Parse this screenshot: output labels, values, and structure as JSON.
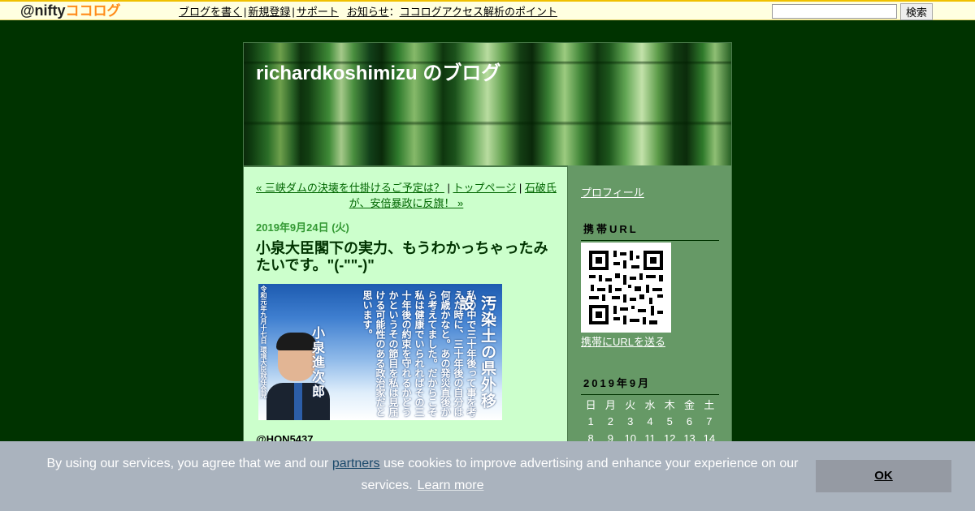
{
  "topbar": {
    "logo_at": "@nifty",
    "logo_kokolog": "ココログ",
    "links": [
      "ブログを書く",
      "新規登録",
      "サポート"
    ],
    "news_label": "お知らせ",
    "news_link": "ココログアクセス解析のポイント",
    "search_button": "検索"
  },
  "blog": {
    "title": "richardkoshimizu のブログ"
  },
  "entry": {
    "prev_link": "« 三峡ダムの決壊を仕掛けるご予定は？",
    "top_link": "トップページ",
    "next_link": "石破氏が、安倍暴政に反旗！ »",
    "date": "2019年9月24日 (火)",
    "title": "小泉大臣閣下の実力、もうわかっちゃったみたいです。\"(-\"\"-)\"",
    "image": {
      "title": "汚染土の県外移設",
      "body": "私の中で三十年後って事を考えた時に、三十年後の自分は何歳かなと。あの発災直後から考えてました。だからこそ私は健康でいられればその三十年後の約束を守れるかどうかというその節目を私は見届ける可能性のある政治家だと思います。",
      "signature": "小泉進次郎",
      "date_text": "令和元年九月十七日 環境大臣就任会見"
    },
    "author": "@HON5437"
  },
  "sidebar": {
    "profile": "プロフィール",
    "mobile_heading": "携帯URL",
    "mobile_link": "携帯にURLを送る",
    "calendar_heading": "2019年9月",
    "weekdays": [
      "日",
      "月",
      "火",
      "水",
      "木",
      "金",
      "土"
    ],
    "weeks": [
      [
        "1",
        "2",
        "3",
        "4",
        "5",
        "6",
        "7"
      ],
      [
        "8",
        "9",
        "10",
        "11",
        "12",
        "13",
        "14"
      ]
    ]
  },
  "cookie": {
    "text_before": "By using our services, you agree that we and our ",
    "partners": "partners",
    "text_after": " use cookies to improve advertising and enhance your experience on our services.",
    "learn_more": "Learn more",
    "ok": "OK"
  },
  "colors": {
    "page_bg": "#003300",
    "main_bg": "#ccffcc",
    "sidebar_bg": "#669966",
    "date": "#339933",
    "cookie_bg": "#aab3be"
  }
}
